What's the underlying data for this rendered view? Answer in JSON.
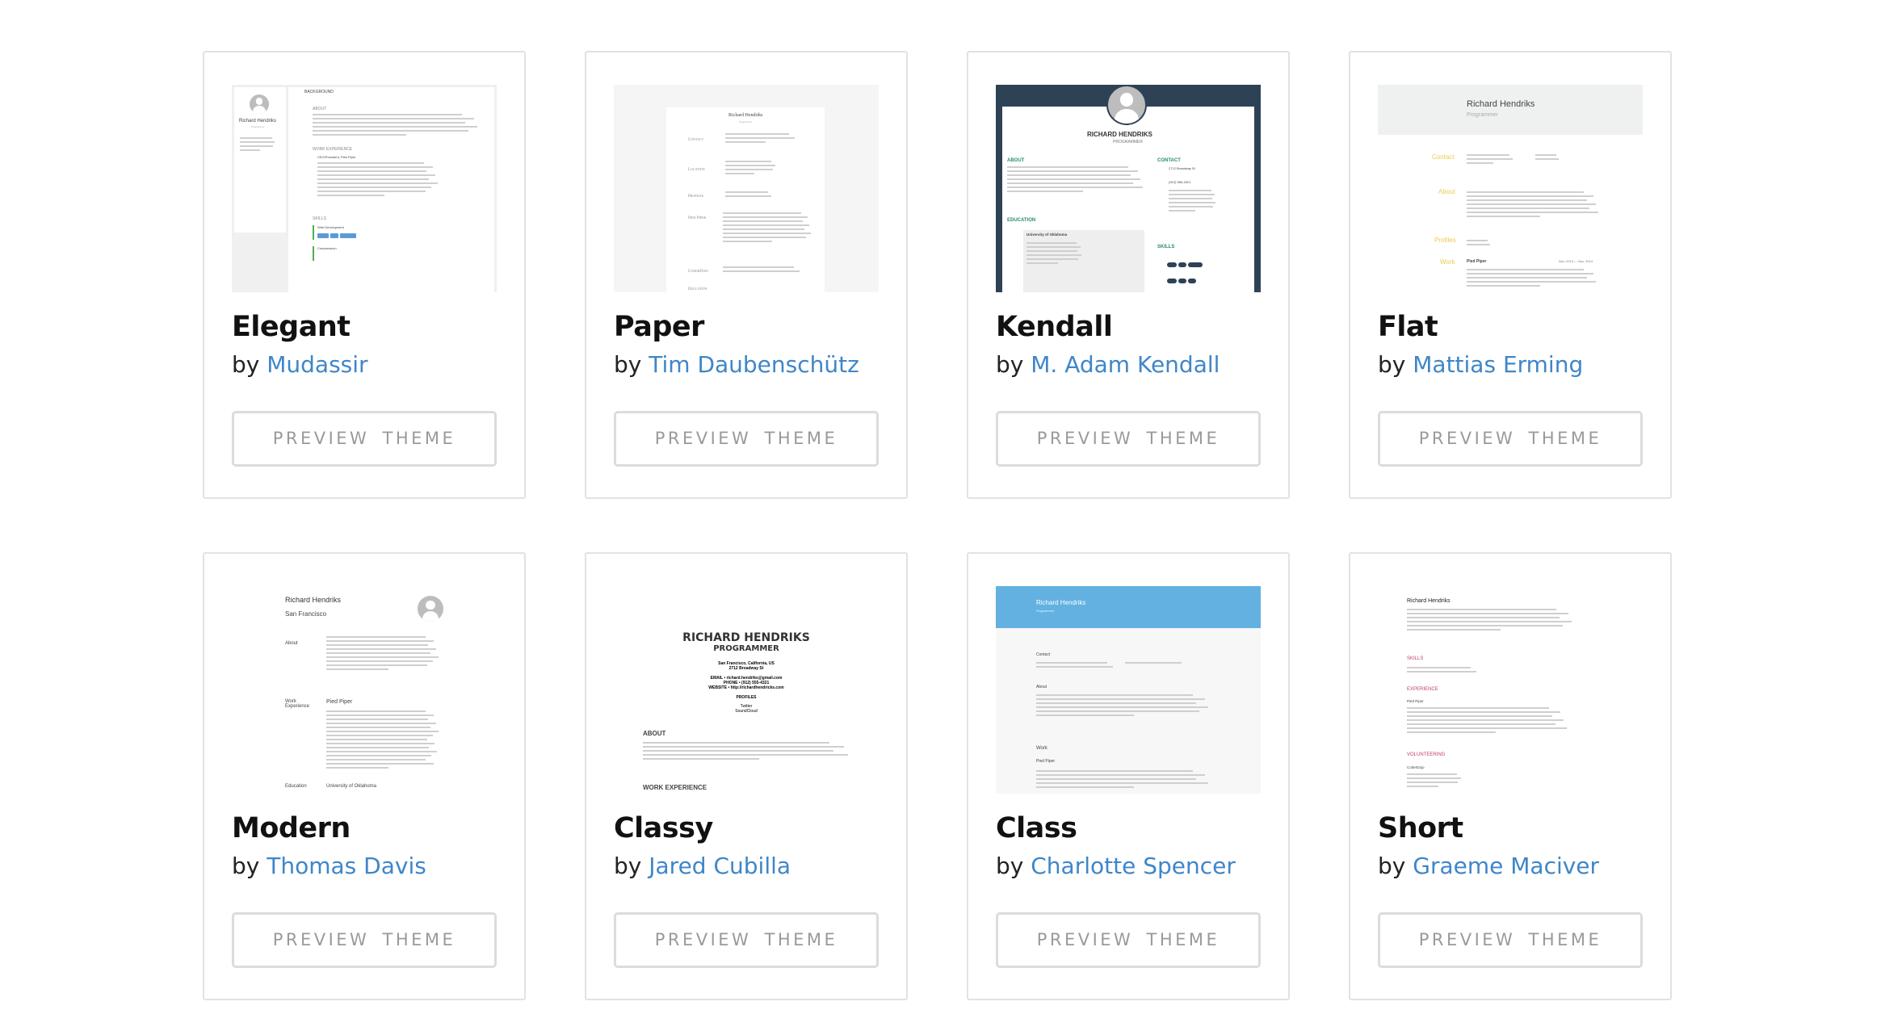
{
  "themes": [
    {
      "name": "Elegant",
      "by": "by",
      "author": "Mudassir",
      "button": "PREVIEW THEME",
      "preview": {
        "name": "Richard Hendriks",
        "role": "Programmer",
        "h1": "BACKGROUND",
        "h2": "ABOUT",
        "h3": "WORK EXPERIENCE",
        "h4": "SKILLS",
        "job": "CEO/President, Pied Piper",
        "skill1": "Web Development",
        "skill2": "Compression"
      }
    },
    {
      "name": "Paper",
      "by": "by",
      "author": "Tim Daubenschütz",
      "button": "PREVIEW THEME",
      "preview": {
        "name": "Richard Hendriks",
        "role": "Programmer",
        "h1": "Contact",
        "h2": "Location",
        "h3": "Profiles",
        "h4": "Pied Piper",
        "h5": "CoderDojo",
        "h6": "Education"
      }
    },
    {
      "name": "Kendall",
      "by": "by",
      "author": "M. Adam Kendall",
      "button": "PREVIEW THEME",
      "preview": {
        "name": "RICHARD HENDRIKS",
        "role": "PROGRAMMER",
        "h1": "ABOUT",
        "h2": "CONTACT",
        "h3": "EDUCATION",
        "h4": "SKILLS",
        "school": "University of Oklahoma",
        "address": "2712 Broadway St",
        "phone": "(912) 555-4321"
      }
    },
    {
      "name": "Flat",
      "by": "by",
      "author": "Mattias Erming",
      "button": "PREVIEW THEME",
      "preview": {
        "name": "Richard Hendriks",
        "role": "Programmer",
        "h1": "Contact",
        "h2": "About",
        "h3": "Profiles",
        "h4": "Work",
        "company": "Pied Piper",
        "dates": "Nov, 2013 — Nov, 2014"
      }
    },
    {
      "name": "Modern",
      "by": "by",
      "author": "Thomas Davis",
      "button": "PREVIEW THEME",
      "preview": {
        "name": "Richard Hendriks",
        "location": "San Francisco",
        "h1": "About",
        "h2": "Work Experience",
        "h3": "Education",
        "company": "Pied Piper",
        "school": "University of Oklahoma"
      }
    },
    {
      "name": "Classy",
      "by": "by",
      "author": "Jared Cubilla",
      "button": "PREVIEW THEME",
      "preview": {
        "name": "RICHARD HENDRIKS",
        "role": "PROGRAMMER",
        "city": "San Francisco, California, US",
        "address": "2712 Broadway St",
        "email": "EMAIL • richard.hendriks@gmail.com",
        "phone": "PHONE • (912) 555-4321",
        "website": "WEBSITE • http://richardhendricks.com",
        "profiles": "PROFILES",
        "p1": "Twitter",
        "p2": "SoundCloud",
        "h1": "ABOUT",
        "h2": "WORK EXPERIENCE"
      }
    },
    {
      "name": "Class",
      "by": "by",
      "author": "Charlotte Spencer",
      "button": "PREVIEW THEME",
      "preview": {
        "name": "Richard Hendriks",
        "role": "Programmer",
        "h1": "Contact",
        "h2": "About",
        "h3": "Work",
        "company": "Pied Piper"
      }
    },
    {
      "name": "Short",
      "by": "by",
      "author": "Graeme Maciver",
      "button": "PREVIEW THEME",
      "preview": {
        "name": "Richard Hendriks",
        "h1": "SKILLS",
        "h2": "EXPERIENCE",
        "h3": "VOLUNTEERING",
        "company": "Pied Piper",
        "org": "CoderDojo"
      }
    }
  ],
  "colors": {
    "link": "#3f86c8",
    "card_border": "#e2e2e2",
    "button_text": "#9a9a9a",
    "kendall_navy": "#2e4256",
    "flat_accent": "#efc94c",
    "class_header": "#63b1e0",
    "short_accent": "#c2416a"
  }
}
